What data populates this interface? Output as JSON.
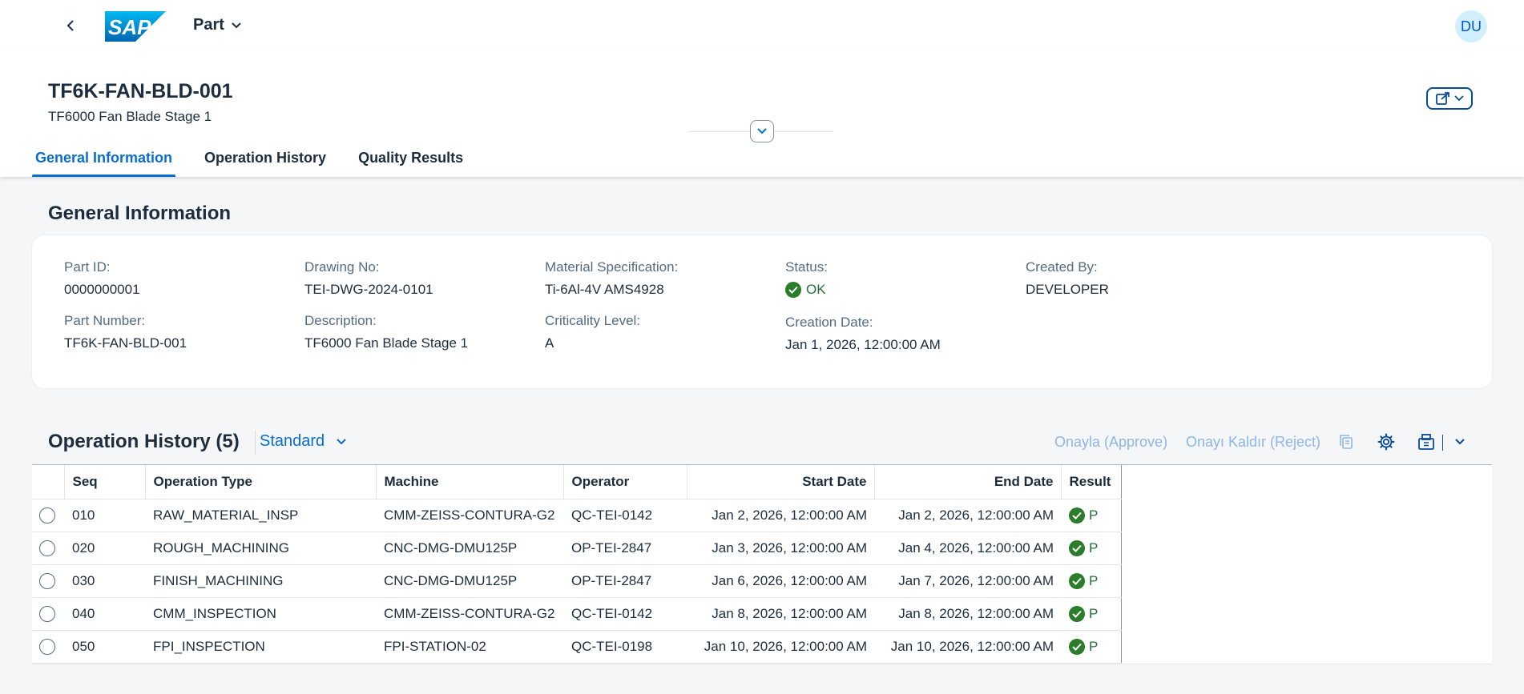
{
  "shell": {
    "app_title": "Part",
    "logo_text": "SAP",
    "avatar_initials": "DU"
  },
  "header": {
    "title": "TF6K-FAN-BLD-001",
    "subtitle": "TF6000 Fan Blade Stage 1"
  },
  "tabs": [
    {
      "label": "General Information",
      "active": true
    },
    {
      "label": "Operation History",
      "active": false
    },
    {
      "label": "Quality Results",
      "active": false
    }
  ],
  "general": {
    "section_title": "General Information",
    "fields": {
      "part_id": {
        "label": "Part ID:",
        "value": "0000000001"
      },
      "part_number": {
        "label": "Part Number:",
        "value": "TF6K-FAN-BLD-001"
      },
      "drawing_no": {
        "label": "Drawing No:",
        "value": "TEI-DWG-2024-0101"
      },
      "description": {
        "label": "Description:",
        "value": "TF6000 Fan Blade Stage 1"
      },
      "material_spec": {
        "label": "Material Specification:",
        "value": "Ti-6Al-4V AMS4928"
      },
      "criticality": {
        "label": "Criticality Level:",
        "value": "A"
      },
      "status": {
        "label": "Status:",
        "value": "OK"
      },
      "creation_date": {
        "label": "Creation Date:",
        "value": "Jan 1, 2026, 12:00:00 AM"
      },
      "created_by": {
        "label": "Created By:",
        "value": "DEVELOPER"
      }
    }
  },
  "operation_history": {
    "title": "Operation History (5)",
    "variant": "Standard",
    "approve_label": "Onayla (Approve)",
    "reject_label": "Onayı Kaldır (Reject)",
    "columns": {
      "seq": "Seq",
      "operation_type": "Operation Type",
      "machine": "Machine",
      "operator": "Operator",
      "start_date": "Start Date",
      "end_date": "End Date",
      "result": "Result"
    },
    "rows": [
      {
        "seq": "010",
        "operation_type": "RAW_MATERIAL_INSP",
        "machine": "CMM-ZEISS-CONTURA-G2",
        "operator": "QC-TEI-0142",
        "start_date": "Jan 2, 2026, 12:00:00 AM",
        "end_date": "Jan 2, 2026, 12:00:00 AM",
        "result": "P"
      },
      {
        "seq": "020",
        "operation_type": "ROUGH_MACHINING",
        "machine": "CNC-DMG-DMU125P",
        "operator": "OP-TEI-2847",
        "start_date": "Jan 3, 2026, 12:00:00 AM",
        "end_date": "Jan 4, 2026, 12:00:00 AM",
        "result": "P"
      },
      {
        "seq": "030",
        "operation_type": "FINISH_MACHINING",
        "machine": "CNC-DMG-DMU125P",
        "operator": "OP-TEI-2847",
        "start_date": "Jan 6, 2026, 12:00:00 AM",
        "end_date": "Jan 7, 2026, 12:00:00 AM",
        "result": "P"
      },
      {
        "seq": "040",
        "operation_type": "CMM_INSPECTION",
        "machine": "CMM-ZEISS-CONTURA-G2",
        "operator": "QC-TEI-0142",
        "start_date": "Jan 8, 2026, 12:00:00 AM",
        "end_date": "Jan 8, 2026, 12:00:00 AM",
        "result": "P"
      },
      {
        "seq": "050",
        "operation_type": "FPI_INSPECTION",
        "machine": "FPI-STATION-02",
        "operator": "QC-TEI-0198",
        "start_date": "Jan 10, 2026, 12:00:00 AM",
        "end_date": "Jan 10, 2026, 12:00:00 AM",
        "result": "P"
      }
    ]
  },
  "colors": {
    "accent": "#0a6ed1",
    "positive": "#256f3a",
    "avatar_bg": "#d1efff"
  },
  "icons": {
    "back": "chevron-left-icon",
    "title_menu": "chevron-down-icon",
    "share": "share-icon",
    "collapse": "chevron-down-icon",
    "status_ok": "check-circle-icon",
    "copy": "copy-icon",
    "settings": "gear-icon",
    "export": "export-icon"
  }
}
